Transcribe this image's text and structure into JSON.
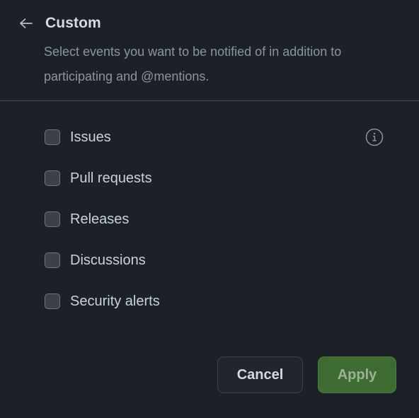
{
  "header": {
    "back_icon": "arrow-left-icon",
    "title": "Custom",
    "subtitle": "Select events you want to be notified of in addition to participating and @mentions."
  },
  "options": [
    {
      "label": "Issues",
      "checked": false,
      "info_icon": "info-icon"
    },
    {
      "label": "Pull requests",
      "checked": false
    },
    {
      "label": "Releases",
      "checked": false
    },
    {
      "label": "Discussions",
      "checked": false
    },
    {
      "label": "Security alerts",
      "checked": false
    }
  ],
  "footer": {
    "cancel_label": "Cancel",
    "apply_label": "Apply"
  },
  "colors": {
    "background": "#1c2128",
    "divider": "#464d58",
    "title_text": "#d5dae1",
    "subtitle_text": "#8b949e",
    "label_text": "#c9d1d9",
    "checkbox_fill": "#3c4048",
    "checkbox_border": "#6e7681",
    "cancel_bg": "#21262d",
    "apply_bg": "#3d6b32",
    "apply_text": "#9cb296"
  }
}
